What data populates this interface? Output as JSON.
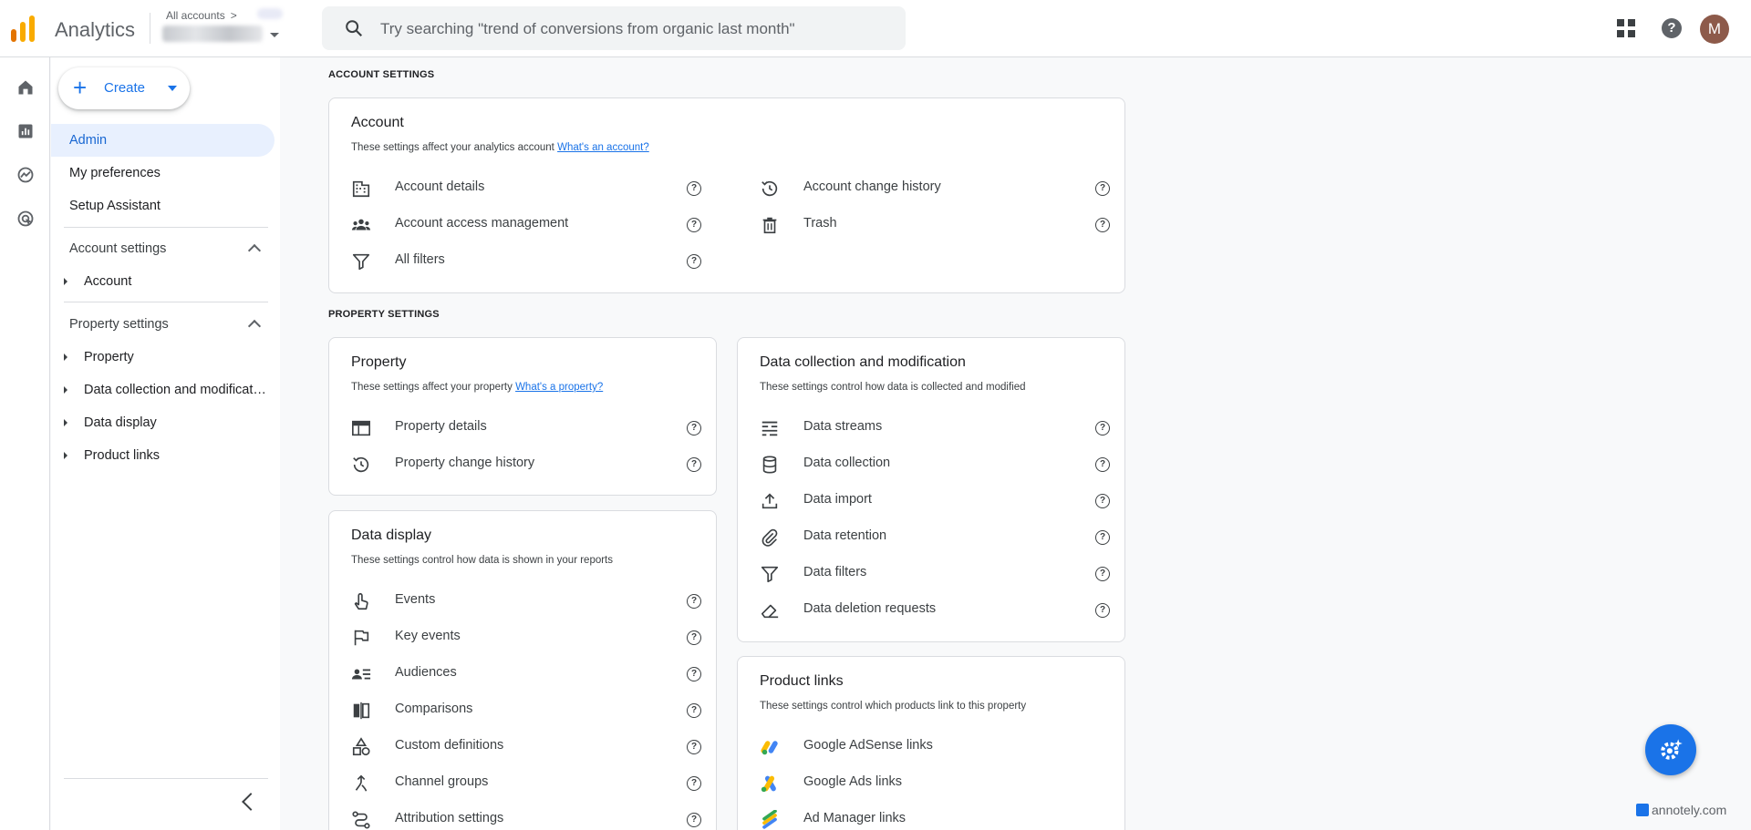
{
  "app": {
    "title": "Analytics"
  },
  "account_switcher": {
    "crumb": "All accounts"
  },
  "search": {
    "placeholder": "Try searching \"trend of conversions from organic last month\""
  },
  "user": {
    "avatar_initial": "M"
  },
  "sidebar": {
    "create_label": "Create",
    "items": [
      {
        "label": "Admin",
        "active": true
      },
      {
        "label": "My preferences"
      },
      {
        "label": "Setup Assistant"
      }
    ],
    "account_settings": {
      "heading": "Account settings",
      "items": [
        {
          "label": "Account"
        }
      ]
    },
    "property_settings": {
      "heading": "Property settings",
      "items": [
        {
          "label": "Property"
        },
        {
          "label": "Data collection and modification"
        },
        {
          "label": "Data display"
        },
        {
          "label": "Product links"
        }
      ]
    }
  },
  "content": {
    "account_settings_label": "ACCOUNT SETTINGS",
    "property_settings_label": "PROPERTY SETTINGS",
    "account_card": {
      "title": "Account",
      "desc": "These settings affect your analytics account",
      "link": "What's an account?",
      "items": [
        {
          "label": "Account details",
          "icon": "building-icon"
        },
        {
          "label": "Account access management",
          "icon": "people-icon"
        },
        {
          "label": "All filters",
          "icon": "filter-icon"
        },
        {
          "label": "Account change history",
          "icon": "history-icon"
        },
        {
          "label": "Trash",
          "icon": "trash-icon"
        }
      ]
    },
    "property_card": {
      "title": "Property",
      "desc": "These settings affect your property",
      "link": "What's a property?",
      "items": [
        {
          "label": "Property details",
          "icon": "web-icon"
        },
        {
          "label": "Property change history",
          "icon": "history-icon"
        }
      ]
    },
    "data_collection_card": {
      "title": "Data collection and modification",
      "desc": "These settings control how data is collected and modified",
      "items": [
        {
          "label": "Data streams",
          "icon": "streams-icon"
        },
        {
          "label": "Data collection",
          "icon": "database-icon"
        },
        {
          "label": "Data import",
          "icon": "upload-icon"
        },
        {
          "label": "Data retention",
          "icon": "paperclip-icon"
        },
        {
          "label": "Data filters",
          "icon": "filter-icon"
        },
        {
          "label": "Data deletion requests",
          "icon": "eraser-icon"
        }
      ]
    },
    "data_display_card": {
      "title": "Data display",
      "desc": "These settings control how data is shown in your reports",
      "items": [
        {
          "label": "Events",
          "icon": "touch-icon"
        },
        {
          "label": "Key events",
          "icon": "flag-icon"
        },
        {
          "label": "Audiences",
          "icon": "audience-icon"
        },
        {
          "label": "Comparisons",
          "icon": "compare-icon"
        },
        {
          "label": "Custom definitions",
          "icon": "shapes-icon"
        },
        {
          "label": "Channel groups",
          "icon": "merge-icon"
        },
        {
          "label": "Attribution settings",
          "icon": "route-icon"
        }
      ]
    },
    "product_links_card": {
      "title": "Product links",
      "desc": "These settings control which products link to this property",
      "items": [
        {
          "label": "Google AdSense links",
          "icon": "adsense-icon"
        },
        {
          "label": "Google Ads links",
          "icon": "google-ads-icon"
        },
        {
          "label": "Ad Manager links",
          "icon": "ad-manager-icon"
        }
      ]
    }
  },
  "watermark": "annotely.com",
  "colors": {
    "accent": "#1a73e8",
    "active_bg": "#e8f0fe",
    "border": "#dadce0",
    "avatar": "#8d5a4a"
  }
}
